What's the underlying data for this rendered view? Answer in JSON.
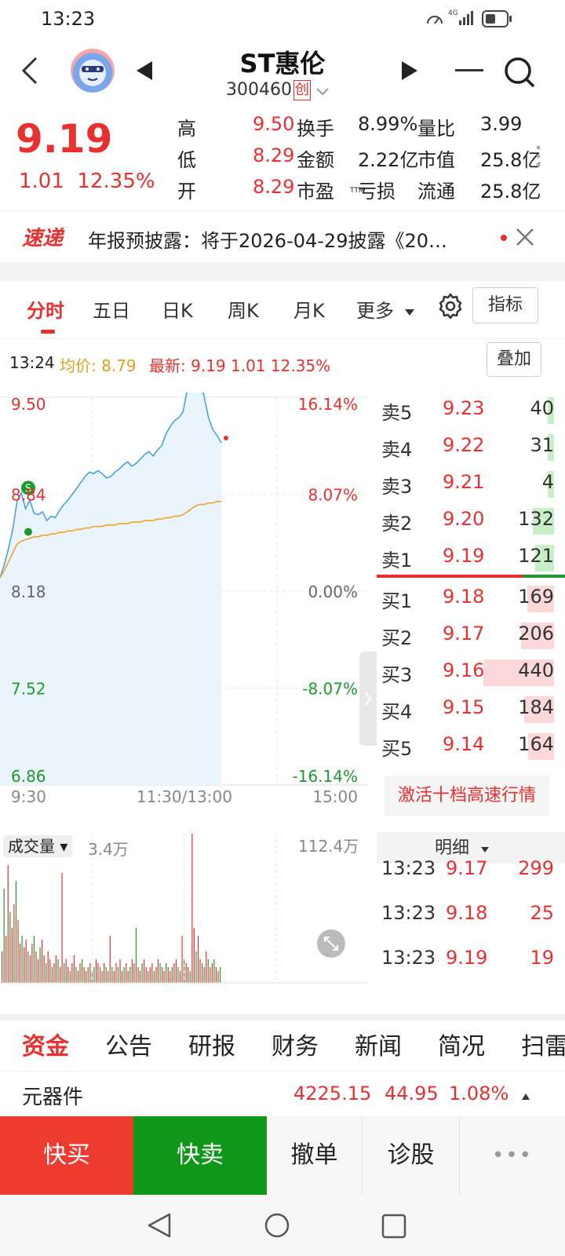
{
  "status": {
    "time": "13:23",
    "network": "4G"
  },
  "header": {
    "name": "ST惠伦",
    "code": "300460",
    "badge": "创"
  },
  "quote": {
    "price": "9.19",
    "change": "1.01",
    "change_pct": "12.35%",
    "stats": [
      {
        "l1": "高",
        "v1": "9.50",
        "l2": "换手",
        "v2": "8.99%",
        "l3": "量比",
        "v3": "3.99"
      },
      {
        "l1": "低",
        "v1": "8.29",
        "l2": "金额",
        "v2": "2.22亿",
        "l3": "市值",
        "v3": "25.8亿"
      },
      {
        "l1": "开",
        "v1": "8.29",
        "l2": "市盈",
        "v2": "亏损",
        "l3": "流通",
        "v3": "25.8亿"
      }
    ],
    "pe_suffix": "TTM"
  },
  "news": {
    "logo": "速递",
    "text": "年报预披露：将于2026-04-29披露《20…"
  },
  "tabs": {
    "items": [
      "分时",
      "五日",
      "日K",
      "周K",
      "月K",
      "更多"
    ],
    "active": 0,
    "indicator": "指标"
  },
  "info": {
    "time": "13:24",
    "avg_label": "均价:",
    "avg": "8.79",
    "latest_label": "最新:",
    "latest": "9.19 1.01 12.35%",
    "overlay": "叠加"
  },
  "chart_data": {
    "type": "line",
    "ylim": [
      6.86,
      9.5
    ],
    "y_ticks_left": [
      "9.50",
      "8.84",
      "8.18",
      "7.52",
      "6.86"
    ],
    "y_ticks_right": [
      "16.14%",
      "8.07%",
      "0.00%",
      "-8.07%",
      "-16.14%"
    ],
    "x_ticks": [
      "9:30",
      "11:30/13:00",
      "15:00"
    ],
    "prev_close": 8.18,
    "series": [
      {
        "name": "最新",
        "color": "#4aa3df",
        "values": [
          8.27,
          8.36,
          8.47,
          8.6,
          8.79,
          8.85,
          8.74,
          8.8,
          8.71,
          8.7,
          8.72,
          8.66,
          8.69,
          8.68,
          8.73,
          8.77,
          8.8,
          8.84,
          8.88,
          8.92,
          8.96,
          8.99,
          8.98,
          9.0,
          8.98,
          8.95,
          8.96,
          8.99,
          9.01,
          9.04,
          9.06,
          9.03,
          9.05,
          9.08,
          9.11,
          9.13,
          9.1,
          9.14,
          9.17,
          9.25,
          9.3,
          9.34,
          9.36,
          9.4,
          9.55,
          9.73,
          9.85,
          9.62,
          9.5,
          9.36,
          9.28,
          9.24,
          9.19
        ]
      },
      {
        "name": "均价",
        "color": "#f0a32a",
        "values": [
          8.27,
          8.32,
          8.38,
          8.44,
          8.5,
          8.52,
          8.53,
          8.54,
          8.55,
          8.55,
          8.56,
          8.56,
          8.57,
          8.57,
          8.58,
          8.58,
          8.59,
          8.59,
          8.6,
          8.6,
          8.61,
          8.61,
          8.62,
          8.62,
          8.62,
          8.63,
          8.63,
          8.63,
          8.64,
          8.64,
          8.64,
          8.65,
          8.65,
          8.65,
          8.66,
          8.66,
          8.66,
          8.67,
          8.67,
          8.68,
          8.68,
          8.69,
          8.69,
          8.7,
          8.72,
          8.74,
          8.76,
          8.77,
          8.77,
          8.78,
          8.78,
          8.79,
          8.79
        ]
      }
    ]
  },
  "order_book": {
    "asks": [
      {
        "label": "卖5",
        "price": "9.23",
        "qty": "40",
        "frac": 0.09
      },
      {
        "label": "卖4",
        "price": "9.22",
        "qty": "31",
        "frac": 0.07
      },
      {
        "label": "卖3",
        "price": "9.21",
        "qty": "4",
        "frac": 0.01
      },
      {
        "label": "卖2",
        "price": "9.20",
        "qty": "132",
        "frac": 0.3
      },
      {
        "label": "卖1",
        "price": "9.19",
        "qty": "121",
        "frac": 0.27
      }
    ],
    "bids": [
      {
        "label": "买1",
        "price": "9.18",
        "qty": "169",
        "frac": 0.38
      },
      {
        "label": "买2",
        "price": "9.17",
        "qty": "206",
        "frac": 0.47
      },
      {
        "label": "买3",
        "price": "9.16",
        "qty": "440",
        "frac": 1.0
      },
      {
        "label": "买4",
        "price": "9.15",
        "qty": "184",
        "frac": 0.42
      },
      {
        "label": "买5",
        "price": "9.14",
        "qty": "164",
        "frac": 0.37
      }
    ],
    "activate": "激活十档高速行情"
  },
  "volume": {
    "label": "成交量",
    "current": "3.4万",
    "max": "112.4万"
  },
  "detail": {
    "title": "明细",
    "rows": [
      {
        "time": "13:23",
        "price": "9.17",
        "qty": "299"
      },
      {
        "time": "13:23",
        "price": "9.18",
        "qty": "25"
      },
      {
        "time": "13:23",
        "price": "9.19",
        "qty": "19"
      }
    ]
  },
  "bottom_tabs": {
    "items": [
      "资金",
      "公告",
      "研报",
      "财务",
      "新闻",
      "简况",
      "扫雷"
    ],
    "active": 0
  },
  "sector": {
    "name": "元器件",
    "value": "4225.15",
    "change": "44.95",
    "pct": "1.08%"
  },
  "actions": {
    "buy": "快买",
    "sell": "快卖",
    "cancel": "撤单",
    "diagnose": "诊股",
    "more": "•••"
  },
  "colors": {
    "up": "#e93030",
    "down": "#1e9a2c",
    "buy_bg": "#ee3b30",
    "sell_bg": "#109619",
    "price_line": "#4aa3df",
    "avg_line": "#f0a32a"
  }
}
